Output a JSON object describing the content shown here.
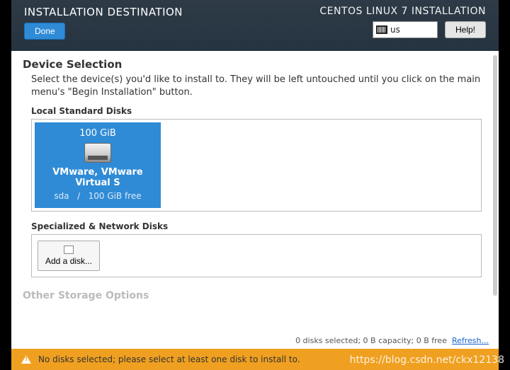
{
  "header": {
    "page_title": "INSTALLATION DESTINATION",
    "done_label": "Done",
    "installer_title": "CENTOS LINUX 7 INSTALLATION",
    "keyboard_layout": "us",
    "help_label": "Help!"
  },
  "device_selection": {
    "title": "Device Selection",
    "description": "Select the device(s) you'd like to install to.  They will be left untouched until you click on the main menu's \"Begin Installation\" button."
  },
  "local_disks": {
    "heading": "Local Standard Disks",
    "disk": {
      "size": "100 GiB",
      "name": "VMware, VMware Virtual S",
      "device": "sda",
      "separator": "/",
      "free": "100 GiB free"
    }
  },
  "network_disks": {
    "heading": "Specialized & Network Disks",
    "add_label": "Add a disk..."
  },
  "other_storage": {
    "heading": "Other Storage Options"
  },
  "footer": {
    "status": "0 disks selected; 0 B capacity; 0 B free",
    "refresh": "Refresh..."
  },
  "warning": {
    "message": "No disks selected; please select at least one disk to install to."
  },
  "watermark": "https://blog.csdn.net/ckx12138"
}
